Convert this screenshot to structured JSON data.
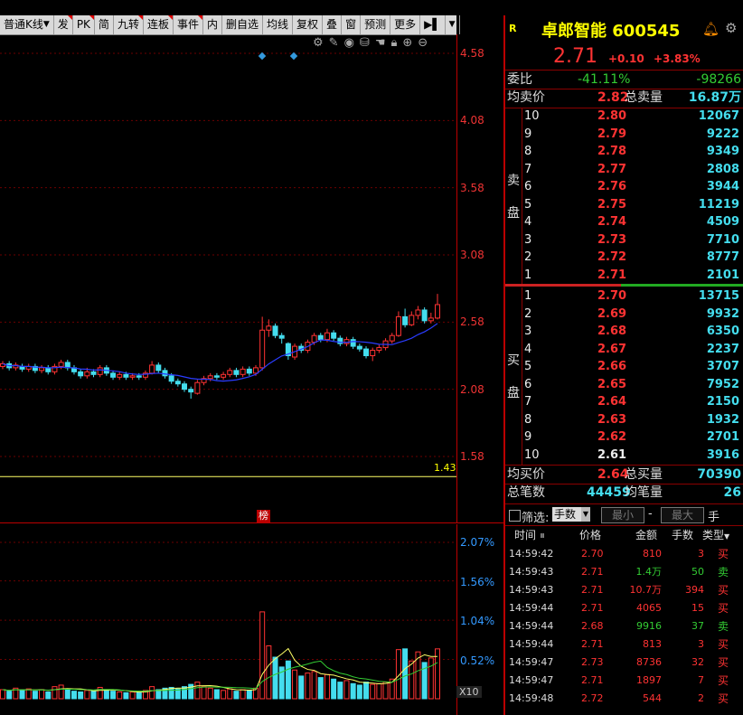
{
  "toolbar": {
    "chart_type": "普通K线",
    "buttons": [
      "发",
      "PK",
      "简",
      "九转",
      "连板",
      "事件",
      "内",
      "删自选",
      "均线",
      "复权",
      "叠",
      "窗",
      "预测",
      "更多"
    ]
  },
  "chart": {
    "price_axis": [
      "4.58",
      "4.08",
      "3.58",
      "3.08",
      "2.58",
      "2.08",
      "1.58"
    ],
    "min_price_label": "1.43",
    "vol_axis": [
      "2.07%",
      "1.56%",
      "1.04%",
      "0.52%"
    ],
    "vol_scale": "X10",
    "bang_label": "榜"
  },
  "stock": {
    "name": "卓郎智能 600545",
    "price": "2.71",
    "change": "+0.10",
    "change_pct": "+3.83%",
    "weibi_label": "委比",
    "weibi_pct": "-41.11%",
    "weibi_diff": "-98266",
    "avg_sell_label": "均卖价",
    "avg_sell": "2.82",
    "total_sell_label": "总卖量",
    "total_sell": "16.87万",
    "sell_side_label": [
      "卖",
      "盘"
    ],
    "buy_side_label": [
      "买",
      "盘"
    ],
    "avg_buy_label": "均买价",
    "avg_buy": "2.64",
    "total_buy_label": "总买量",
    "total_buy": "70390",
    "total_trades_label": "总笔数",
    "total_trades": "44459",
    "avg_trade_label": "均笔量",
    "avg_trade": "26"
  },
  "sell_levels": [
    {
      "level": "10",
      "price": "2.80",
      "vol": "12067"
    },
    {
      "level": "9",
      "price": "2.79",
      "vol": "9222"
    },
    {
      "level": "8",
      "price": "2.78",
      "vol": "9349"
    },
    {
      "level": "7",
      "price": "2.77",
      "vol": "2808"
    },
    {
      "level": "6",
      "price": "2.76",
      "vol": "3944"
    },
    {
      "level": "5",
      "price": "2.75",
      "vol": "11219"
    },
    {
      "level": "4",
      "price": "2.74",
      "vol": "4509"
    },
    {
      "level": "3",
      "price": "2.73",
      "vol": "7710"
    },
    {
      "level": "2",
      "price": "2.72",
      "vol": "8777"
    },
    {
      "level": "1",
      "price": "2.71",
      "vol": "2101"
    }
  ],
  "buy_levels": [
    {
      "level": "1",
      "price": "2.70",
      "vol": "13715"
    },
    {
      "level": "2",
      "price": "2.69",
      "vol": "9932"
    },
    {
      "level": "3",
      "price": "2.68",
      "vol": "6350"
    },
    {
      "level": "4",
      "price": "2.67",
      "vol": "2237"
    },
    {
      "level": "5",
      "price": "2.66",
      "vol": "3707"
    },
    {
      "level": "6",
      "price": "2.65",
      "vol": "7952"
    },
    {
      "level": "7",
      "price": "2.64",
      "vol": "2150"
    },
    {
      "level": "8",
      "price": "2.63",
      "vol": "1932"
    },
    {
      "level": "9",
      "price": "2.62",
      "vol": "2701"
    },
    {
      "level": "10",
      "price": "2.61",
      "vol": "3916"
    }
  ],
  "filter": {
    "label": "筛选:",
    "unit_select": "手数",
    "min_placeholder": "最小",
    "max_placeholder": "最大",
    "dash": "-",
    "unit": "手"
  },
  "ticks_header": {
    "time": "时间",
    "price": "价格",
    "amount": "金额",
    "hands": "手数",
    "type": "类型"
  },
  "ticks": [
    {
      "time": "14:59:42",
      "price": "2.70",
      "amount": "810",
      "hands": "3",
      "type": "买",
      "dir": "buy"
    },
    {
      "time": "14:59:43",
      "price": "2.71",
      "amount": "1.4万",
      "hands": "50",
      "type": "卖",
      "dir": "sell"
    },
    {
      "time": "14:59:43",
      "price": "2.71",
      "amount": "10.7万",
      "hands": "394",
      "type": "买",
      "dir": "buy"
    },
    {
      "time": "14:59:44",
      "price": "2.71",
      "amount": "4065",
      "hands": "15",
      "type": "买",
      "dir": "buy"
    },
    {
      "time": "14:59:44",
      "price": "2.68",
      "amount": "9916",
      "hands": "37",
      "type": "卖",
      "dir": "sell"
    },
    {
      "time": "14:59:44",
      "price": "2.71",
      "amount": "813",
      "hands": "3",
      "type": "买",
      "dir": "buy"
    },
    {
      "time": "14:59:47",
      "price": "2.73",
      "amount": "8736",
      "hands": "32",
      "type": "买",
      "dir": "buy"
    },
    {
      "time": "14:59:47",
      "price": "2.71",
      "amount": "1897",
      "hands": "7",
      "type": "买",
      "dir": "buy"
    },
    {
      "time": "14:59:48",
      "price": "2.72",
      "amount": "544",
      "hands": "2",
      "type": "买",
      "dir": "buy"
    }
  ],
  "candles": [
    {
      "o": 2.25,
      "c": 2.27,
      "h": 2.29,
      "l": 2.23
    },
    {
      "o": 2.27,
      "c": 2.24,
      "h": 2.29,
      "l": 2.22
    },
    {
      "o": 2.24,
      "c": 2.26,
      "h": 2.28,
      "l": 2.22
    },
    {
      "o": 2.25,
      "c": 2.23,
      "h": 2.27,
      "l": 2.21
    },
    {
      "o": 2.23,
      "c": 2.25,
      "h": 2.27,
      "l": 2.21
    },
    {
      "o": 2.25,
      "c": 2.22,
      "h": 2.27,
      "l": 2.2
    },
    {
      "o": 2.22,
      "c": 2.24,
      "h": 2.26,
      "l": 2.2
    },
    {
      "o": 2.24,
      "c": 2.21,
      "h": 2.26,
      "l": 2.19
    },
    {
      "o": 2.21,
      "c": 2.25,
      "h": 2.27,
      "l": 2.19
    },
    {
      "o": 2.25,
      "c": 2.28,
      "h": 2.3,
      "l": 2.23
    },
    {
      "o": 2.28,
      "c": 2.24,
      "h": 2.3,
      "l": 2.22
    },
    {
      "o": 2.24,
      "c": 2.21,
      "h": 2.26,
      "l": 2.19
    },
    {
      "o": 2.21,
      "c": 2.18,
      "h": 2.23,
      "l": 2.16
    },
    {
      "o": 2.18,
      "c": 2.21,
      "h": 2.24,
      "l": 2.16
    },
    {
      "o": 2.21,
      "c": 2.19,
      "h": 2.23,
      "l": 2.17
    },
    {
      "o": 2.19,
      "c": 2.24,
      "h": 2.26,
      "l": 2.17
    },
    {
      "o": 2.24,
      "c": 2.2,
      "h": 2.26,
      "l": 2.18
    },
    {
      "o": 2.2,
      "c": 2.17,
      "h": 2.22,
      "l": 2.15
    },
    {
      "o": 2.17,
      "c": 2.19,
      "h": 2.21,
      "l": 2.15
    },
    {
      "o": 2.19,
      "c": 2.17,
      "h": 2.21,
      "l": 2.15
    },
    {
      "o": 2.17,
      "c": 2.18,
      "h": 2.2,
      "l": 2.15
    },
    {
      "o": 2.18,
      "c": 2.17,
      "h": 2.2,
      "l": 2.15
    },
    {
      "o": 2.17,
      "c": 2.2,
      "h": 2.22,
      "l": 2.15
    },
    {
      "o": 2.2,
      "c": 2.26,
      "h": 2.29,
      "l": 2.19
    },
    {
      "o": 2.26,
      "c": 2.22,
      "h": 2.28,
      "l": 2.2
    },
    {
      "o": 2.22,
      "c": 2.18,
      "h": 2.24,
      "l": 2.16
    },
    {
      "o": 2.18,
      "c": 2.14,
      "h": 2.2,
      "l": 2.12
    },
    {
      "o": 2.14,
      "c": 2.12,
      "h": 2.16,
      "l": 2.1
    },
    {
      "o": 2.12,
      "c": 2.08,
      "h": 2.14,
      "l": 2.06
    },
    {
      "o": 2.08,
      "c": 2.06,
      "h": 2.1,
      "l": 2.01
    },
    {
      "o": 2.05,
      "c": 2.13,
      "h": 2.15,
      "l": 2.04
    },
    {
      "o": 2.13,
      "c": 2.16,
      "h": 2.18,
      "l": 2.11
    },
    {
      "o": 2.16,
      "c": 2.18,
      "h": 2.2,
      "l": 2.14
    },
    {
      "o": 2.18,
      "c": 2.17,
      "h": 2.2,
      "l": 2.15
    },
    {
      "o": 2.17,
      "c": 2.19,
      "h": 2.21,
      "l": 2.15
    },
    {
      "o": 2.19,
      "c": 2.22,
      "h": 2.24,
      "l": 2.17
    },
    {
      "o": 2.22,
      "c": 2.19,
      "h": 2.24,
      "l": 2.17
    },
    {
      "o": 2.19,
      "c": 2.23,
      "h": 2.25,
      "l": 2.17
    },
    {
      "o": 2.23,
      "c": 2.2,
      "h": 2.25,
      "l": 2.18
    },
    {
      "o": 2.2,
      "c": 2.24,
      "h": 2.26,
      "l": 2.18
    },
    {
      "o": 2.24,
      "c": 2.52,
      "h": 2.62,
      "l": 2.22
    },
    {
      "o": 2.52,
      "c": 2.55,
      "h": 2.6,
      "l": 2.47
    },
    {
      "o": 2.55,
      "c": 2.48,
      "h": 2.57,
      "l": 2.46
    },
    {
      "o": 2.48,
      "c": 2.46,
      "h": 2.5,
      "l": 2.42
    },
    {
      "o": 2.42,
      "c": 2.33,
      "h": 2.43,
      "l": 2.3
    },
    {
      "o": 2.32,
      "c": 2.4,
      "h": 2.42,
      "l": 2.3
    },
    {
      "o": 2.4,
      "c": 2.37,
      "h": 2.42,
      "l": 2.35
    },
    {
      "o": 2.37,
      "c": 2.43,
      "h": 2.45,
      "l": 2.35
    },
    {
      "o": 2.43,
      "c": 2.48,
      "h": 2.5,
      "l": 2.41
    },
    {
      "o": 2.48,
      "c": 2.45,
      "h": 2.5,
      "l": 2.43
    },
    {
      "o": 2.45,
      "c": 2.5,
      "h": 2.53,
      "l": 2.43
    },
    {
      "o": 2.5,
      "c": 2.46,
      "h": 2.52,
      "l": 2.44
    },
    {
      "o": 2.46,
      "c": 2.42,
      "h": 2.48,
      "l": 2.4
    },
    {
      "o": 2.42,
      "c": 2.45,
      "h": 2.47,
      "l": 2.4
    },
    {
      "o": 2.45,
      "c": 2.4,
      "h": 2.47,
      "l": 2.38
    },
    {
      "o": 2.4,
      "c": 2.38,
      "h": 2.42,
      "l": 2.36
    },
    {
      "o": 2.38,
      "c": 2.33,
      "h": 2.4,
      "l": 2.31
    },
    {
      "o": 2.33,
      "c": 2.37,
      "h": 2.39,
      "l": 2.29
    },
    {
      "o": 2.37,
      "c": 2.39,
      "h": 2.41,
      "l": 2.35
    },
    {
      "o": 2.39,
      "c": 2.44,
      "h": 2.46,
      "l": 2.37
    },
    {
      "o": 2.44,
      "c": 2.48,
      "h": 2.5,
      "l": 2.42
    },
    {
      "o": 2.48,
      "c": 2.62,
      "h": 2.66,
      "l": 2.47
    },
    {
      "o": 2.62,
      "c": 2.56,
      "h": 2.68,
      "l": 2.54
    },
    {
      "o": 2.56,
      "c": 2.63,
      "h": 2.66,
      "l": 2.55
    },
    {
      "o": 2.63,
      "c": 2.67,
      "h": 2.7,
      "l": 2.6
    },
    {
      "o": 2.67,
      "c": 2.59,
      "h": 2.69,
      "l": 2.57
    },
    {
      "o": 2.59,
      "c": 2.61,
      "h": 2.65,
      "l": 2.57
    },
    {
      "o": 2.61,
      "c": 2.71,
      "h": 2.79,
      "l": 2.6
    }
  ],
  "volumes": [
    0.12,
    0.1,
    0.14,
    0.11,
    0.13,
    0.1,
    0.12,
    0.09,
    0.16,
    0.18,
    0.12,
    0.1,
    0.09,
    0.11,
    0.1,
    0.15,
    0.12,
    0.1,
    0.09,
    0.08,
    0.09,
    0.08,
    0.11,
    0.16,
    0.12,
    0.14,
    0.15,
    0.13,
    0.16,
    0.19,
    0.22,
    0.16,
    0.14,
    0.12,
    0.11,
    0.13,
    0.1,
    0.12,
    0.11,
    0.14,
    1.15,
    0.7,
    0.55,
    0.42,
    0.5,
    0.38,
    0.3,
    0.34,
    0.36,
    0.28,
    0.32,
    0.26,
    0.22,
    0.24,
    0.2,
    0.18,
    0.22,
    0.19,
    0.2,
    0.22,
    0.26,
    0.65,
    0.66,
    0.5,
    0.62,
    0.48,
    0.54,
    0.66
  ],
  "colors": {
    "up": "#ff3333",
    "down": "#44ddee",
    "ma": "#2a3cff",
    "vol_ma1": "#ffff66",
    "vol_ma2": "#33cc33",
    "grid": "#6b0000"
  }
}
